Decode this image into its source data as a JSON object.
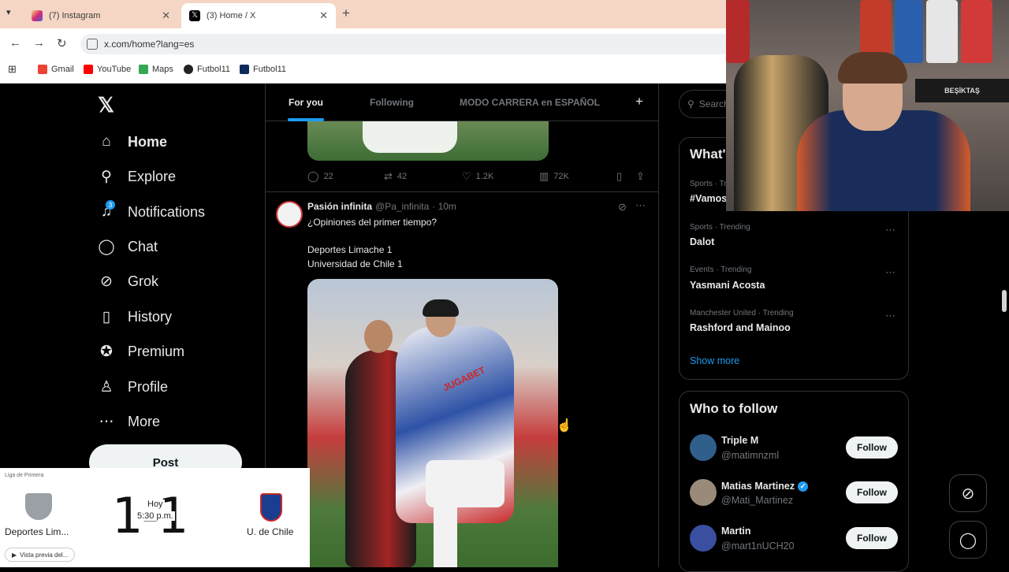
{
  "browser": {
    "tabs": [
      {
        "title": "(7) Instagram",
        "favicon_color": "#e1306c"
      },
      {
        "title": "(3) Home / X",
        "favicon_color": "#000000"
      }
    ],
    "new_tab": "+",
    "close": "✕",
    "url": "x.com/home?lang=es",
    "bookmarks": [
      {
        "label": "Gmail",
        "color": "#ea4335"
      },
      {
        "label": "YouTube",
        "color": "#ff0000"
      },
      {
        "label": "Maps",
        "color": "#34a853"
      },
      {
        "label": "Futbol11",
        "color": "#222222"
      },
      {
        "label": "Futbol11",
        "color": "#0d2a5c"
      }
    ]
  },
  "sidebar": {
    "logo": "𝕏",
    "items": [
      {
        "label": "Home",
        "icon": "home-icon"
      },
      {
        "label": "Explore",
        "icon": "search-icon"
      },
      {
        "label": "Notifications",
        "icon": "bell-icon",
        "badge": "3"
      },
      {
        "label": "Chat",
        "icon": "chat-icon"
      },
      {
        "label": "Grok",
        "icon": "grok-icon"
      },
      {
        "label": "History",
        "icon": "bookmark-icon"
      },
      {
        "label": "Premium",
        "icon": "verified-icon"
      },
      {
        "label": "Profile",
        "icon": "person-icon"
      },
      {
        "label": "More",
        "icon": "more-icon"
      }
    ],
    "post_label": "Post"
  },
  "feed": {
    "tabs": [
      "For you",
      "Following",
      "MODO CARRERA en ESPAÑOL"
    ],
    "add_tab": "+",
    "prev_actions": {
      "replies": "22",
      "reposts": "42",
      "likes": "1.2K",
      "views": "72K"
    },
    "tweet": {
      "name": "Pasión infinita",
      "handle": "@Pa_infinita",
      "time": "· 10m",
      "line1": "¿Opiniones del primer tiempo?",
      "line2": "Deportes Limache 1",
      "line3": "Universidad de Chile 1",
      "image_text": "JUGABET"
    }
  },
  "right": {
    "search_placeholder": "Search",
    "trends_title": "What's happening",
    "trends": [
      {
        "meta": "Sports · Trending",
        "name": "#Vamos"
      },
      {
        "meta": "Sports · Trending",
        "name": "Dalot"
      },
      {
        "meta": "Events · Trending",
        "name": "Yasmani Acosta"
      },
      {
        "meta": "Manchester United · Trending",
        "name": "Rashford and Mainoo"
      }
    ],
    "show_more": "Show more",
    "wtf_title": "Who to follow",
    "follow": [
      {
        "name": "Triple M",
        "handle": "@matimnzml",
        "verified": false,
        "avatar_color": "#2f5f8a"
      },
      {
        "name": "Matias Martinez",
        "handle": "@Mati_Martinez",
        "verified": true,
        "avatar_color": "#9a8a7a"
      },
      {
        "name": "Martin",
        "handle": "@mart1nUCH20",
        "verified": false,
        "avatar_color": "#3a4fa0"
      }
    ],
    "follow_label": "Follow"
  },
  "webcam": {
    "banner": "BEŞİKTAŞ"
  },
  "scoreboard": {
    "league": "Liga de Primera",
    "home": "Deportes Lim...",
    "away": "U. de Chile",
    "score": "1-1",
    "day": "Hoy",
    "time": "5:30 p.m.",
    "preview": "Vista previa del..."
  }
}
